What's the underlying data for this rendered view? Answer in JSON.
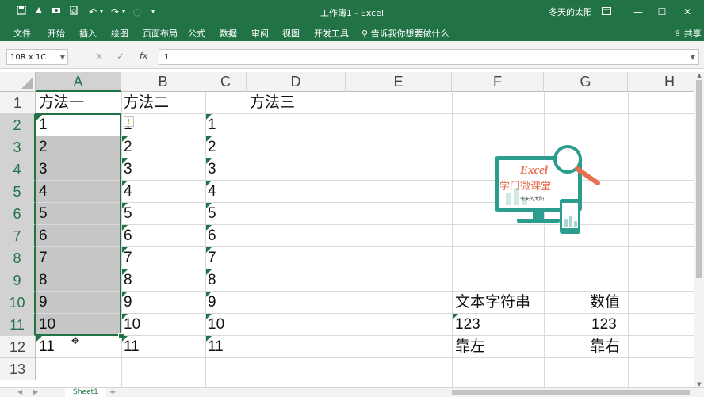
{
  "titlebar": {
    "title": "工作簿1 - Excel",
    "user": "冬天的太阳",
    "qa_icons": [
      "save-icon",
      "touch-mode-icon",
      "tools-icon",
      "print-preview-icon",
      "undo-icon",
      "redo-icon",
      "circle-icon",
      "customize-icon"
    ],
    "window_buttons": [
      "ribbon-options-icon",
      "minimize-icon",
      "maximize-icon",
      "close-icon"
    ]
  },
  "ribbon": {
    "tabs": [
      "文件",
      "开始",
      "插入",
      "绘图",
      "页面布局",
      "公式",
      "数据",
      "审阅",
      "视图",
      "开发工具"
    ],
    "search": "告诉我你想要做什么",
    "share": "共享"
  },
  "formula_bar": {
    "name_box": "10R x 1C",
    "cancel": "×",
    "enter": "✓",
    "fx": "fx",
    "value": "1"
  },
  "columns": [
    "A",
    "B",
    "C",
    "D",
    "E",
    "F",
    "G",
    "H"
  ],
  "rows": [
    "1",
    "2",
    "3",
    "4",
    "5",
    "6",
    "7",
    "8",
    "9",
    "10",
    "11",
    "12",
    "13"
  ],
  "cells": {
    "A1": "方法一",
    "B1": "方法二",
    "D1": "方法三",
    "A": [
      "1",
      "2",
      "3",
      "4",
      "5",
      "6",
      "7",
      "8",
      "9",
      "10",
      "11"
    ],
    "B": [
      "1",
      "2",
      "3",
      "4",
      "5",
      "6",
      "7",
      "8",
      "9",
      "10",
      "11"
    ],
    "C": [
      "1",
      "2",
      "3",
      "4",
      "5",
      "6",
      "7",
      "8",
      "9",
      "10",
      "11"
    ],
    "F10": "文本字符串",
    "G10": "数值",
    "F11": "123",
    "G11": "123",
    "F12": "靠左",
    "G12": "靠右"
  },
  "logo": {
    "brand": "Excel",
    "title": "学门微课堂",
    "subtitle": "冬天的太阳"
  },
  "sheet": {
    "tab": "Sheet1",
    "add": "+"
  },
  "colors": {
    "accent": "#217346",
    "selection": "#c6c6c6",
    "logo_teal": "#2a9d8f",
    "logo_orange": "#e76f51"
  }
}
